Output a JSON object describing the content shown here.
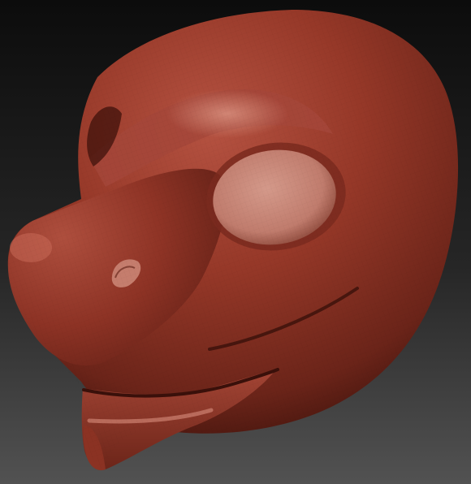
{
  "scene": {
    "background": {
      "top_color": "#0c0c0c",
      "bottom_color": "#525252"
    },
    "model": {
      "kind": "sculpted creature head (side view)",
      "base_color": "#9a3a2c",
      "highlight_color": "#c77463",
      "shadow_color": "#4f1a12",
      "eye_color": "#c98778",
      "mouth_line_color": "#3a100a"
    }
  }
}
